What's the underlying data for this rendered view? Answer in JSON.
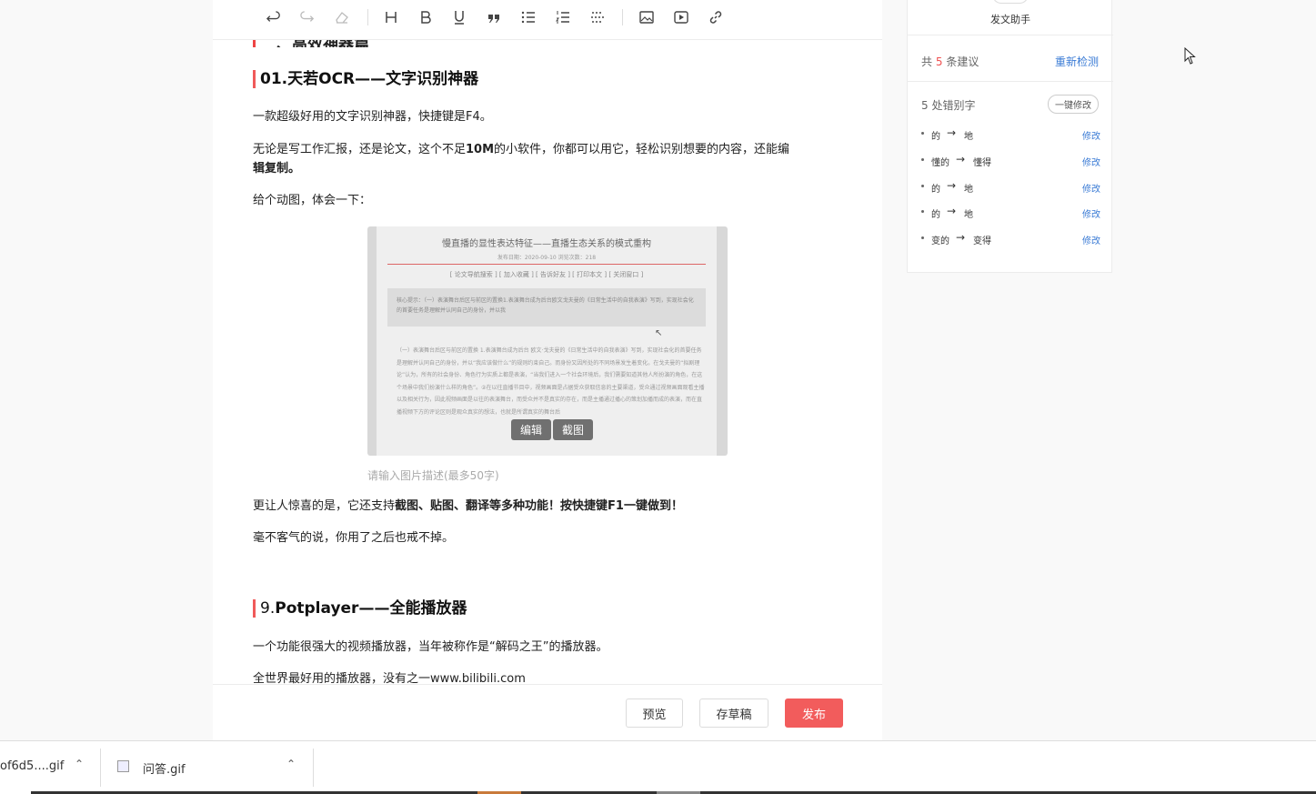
{
  "toolbar": {
    "items": [
      "undo-icon",
      "redo-icon",
      "eraser-icon",
      "heading-icon",
      "bold-icon",
      "underline-icon",
      "quote-icon",
      "bullet-list-icon",
      "numbered-list-icon",
      "divider-icon",
      "image-icon",
      "video-icon",
      "link-icon"
    ]
  },
  "article": {
    "cut_heading": "二、高效神器篇",
    "h_ocr": "01.天若OCR——文字识别神器",
    "p1": "一款超级好用的文字识别神器，快捷键是F4。",
    "p2_a": "无论是写工作汇报，还是论文，这个不足",
    "p2_b": "10M",
    "p2_c": "的小软件，你都可以用它，轻松识别想要的内容，还能编",
    "p2_d": "辑复制。",
    "p3": "给个动图，体会一下：",
    "gif": {
      "title": "慢直播的显性表达特征——直播生态关系的模式重构",
      "meta": "发布日期：2020-09-10  浏览次数：218",
      "nav": "[ 论文导航搜索 ] [ 加入收藏 ] [ 告诉好友 ] [ 打印本文 ] [ 关闭窗口 ]",
      "box_text": "核心提示：（一）表演舞台后区与前区的置换1.表演舞台成为后台欧文戈夫曼的《日常生活中的自我表演》写到，实现社会化的首要任务是理解并认同自己的身份，并以我",
      "body": "（一）表演舞台后区与前区的置换 1.表演舞台成为后台 欧文·戈夫曼的《日常生活中的自我表演》写到，实现社会化的首要任务是理解并认同自己的身份，并以“我应该做什么”的规则约束自己。而身份又因所处的不同场景发生着变化。在戈夫曼的“拟剧理论”认为，所有的社会身份、角色行为实质上都是表演，“当我们进入一个社会环境后，我们需要知道其他人所扮演的角色，在这个场景中我们扮演什么样的角色”。②在以往直播节目中，视频画面是占据受众获取信息的主要渠道，受众通过视频画面观看主播以及相关行为，因此视频画面是以往的表演舞台，而受众并不是真实的存在，而是主播通过播心的策划加播而成的表演，而在直播视频下方的评论区则是观众真实的想法，也就是所谓真实的舞台后",
      "edit_btn": "编辑",
      "crop_btn": "截图"
    },
    "caption": "请输入图片描述(最多50字)",
    "p4_a": "更让人惊喜的是，它还支持",
    "p4_b": "截图、贴图、翻译等多种功能！按快捷键F1一键做到！",
    "p5": "毫不客气的说，你用了之后也戒不掉。",
    "h_pot_num": "9.",
    "h_pot": "Potplayer——全能播放器",
    "p6": "一个功能很强大的视频播放器，当年被称作是“解码之王”的播放器。",
    "p7": "全世界最好用的播放器，没有之一www.bilibili.com"
  },
  "footer": {
    "preview": "预览",
    "draft": "存草稿",
    "publish": "发布"
  },
  "panel": {
    "assistant": "发文助手",
    "count_prefix": "共",
    "count": "5",
    "count_suffix": "条建议",
    "recheck": "重新检测",
    "typo_title": "5 处错别字",
    "fix_all": "一键修改",
    "items": [
      {
        "orig": "的",
        "fixed": "地",
        "action": "修改"
      },
      {
        "orig": "懂的",
        "fixed": "懂得",
        "action": "修改"
      },
      {
        "orig": "的",
        "fixed": "地",
        "action": "修改"
      },
      {
        "orig": "的",
        "fixed": "地",
        "action": "修改"
      },
      {
        "orig": "变的",
        "fixed": "变得",
        "action": "修改"
      }
    ]
  },
  "downloads": [
    {
      "name": "of6d5....gif"
    },
    {
      "name": "问答.gif"
    }
  ],
  "colors": {
    "accent": "#f25c5c",
    "link": "#3a7bd5"
  }
}
